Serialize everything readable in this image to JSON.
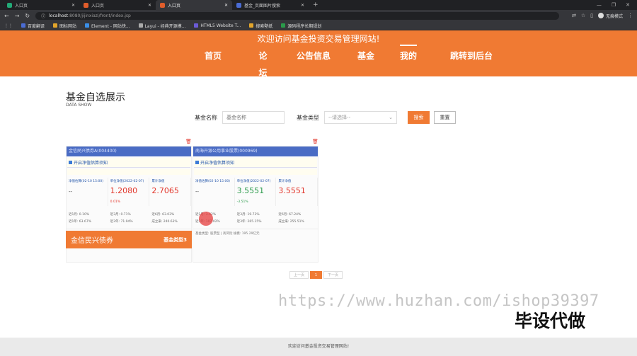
{
  "browser": {
    "tabs": [
      {
        "label": "入口页",
        "active": false
      },
      {
        "label": "入口页",
        "active": false
      },
      {
        "label": "入口页",
        "active": true
      },
      {
        "label": "基金_页面图片搜索",
        "active": false
      }
    ],
    "new_tab": "+",
    "url_host": "localhost",
    "url_path": ":8080/jijinxiazi/front/index.jsp",
    "incognito_label": "无痕模式",
    "bookmarks": [
      "百度翻译",
      "图标网站",
      "Element - 网站快...",
      "Layui - 经典开源模...",
      "HTML5 Website T...",
      "搜索壁纸",
      "源码程序长期规划"
    ]
  },
  "site": {
    "title": "欢迎访问基金投资交易管理网站!",
    "menu": [
      "首页",
      "论坛",
      "公告信息",
      "基金",
      "我的",
      "跳转到后台"
    ],
    "active_menu": "我的",
    "accent_color": "#f07a33"
  },
  "section": {
    "title": "基金自选展示",
    "subtitle": "DATA SHOW"
  },
  "search": {
    "name_label": "基金名称",
    "name_placeholder": "基金名称",
    "type_label": "基金类型",
    "type_placeholder": "--请选择--",
    "search_button": "搜索",
    "reset_button": "重置"
  },
  "cards": [
    {
      "header": "金信民兴债券A(004400)",
      "notice": "开启净值估算须知",
      "metrics": [
        {
          "label": "净值估算(02-10 15:00)",
          "value": "--",
          "sub": ""
        },
        {
          "label": "单位净值(2022-02-07)",
          "value": "1.2080",
          "sub": "0.01%"
        },
        {
          "label": "累计净值",
          "value": "2.7065",
          "sub": ""
        }
      ],
      "rows": [
        "近1月: 0.10%",
        "近3月: 0.71%",
        "近6月: 63.03%",
        "近1年: 63.67%",
        "近3年: 71.94%",
        "成立来: 240.63%"
      ],
      "footer": "基金类型: 债券型 | 中风险   规模: 8.13亿元",
      "banner_name": "金信民兴债券",
      "banner_type": "基金类型3"
    },
    {
      "header": "南海开源公用事业股票(000969)",
      "notice": "开启净值估算须知",
      "metrics": [
        {
          "label": "净值估算(02-10 15:00)",
          "value": "--",
          "sub": ""
        },
        {
          "label": "单位净值(2022-02-07)",
          "value": "3.5551",
          "sub": "-3.51%"
        },
        {
          "label": "累计净值",
          "value": "3.5551",
          "sub": ""
        }
      ],
      "rows": [
        "近1月: 3.42%",
        "近3月: 19.73%",
        "近6月: 67.24%",
        "近1年: 107.02%",
        "近3年: 265.15%",
        "成立来: 255.51%"
      ],
      "footer": "基金类型: 股票型 | 高风险   规模: 195.29亿元",
      "banner_name": "",
      "banner_type": ""
    }
  ],
  "pager": {
    "prev": "上一页",
    "current": "1",
    "next": "下一页"
  },
  "watermark": "https://www.huzhan.com/ishop39397",
  "stamp": "毕设代做",
  "footer": "欢迎访问基金投资交易管理网站!"
}
